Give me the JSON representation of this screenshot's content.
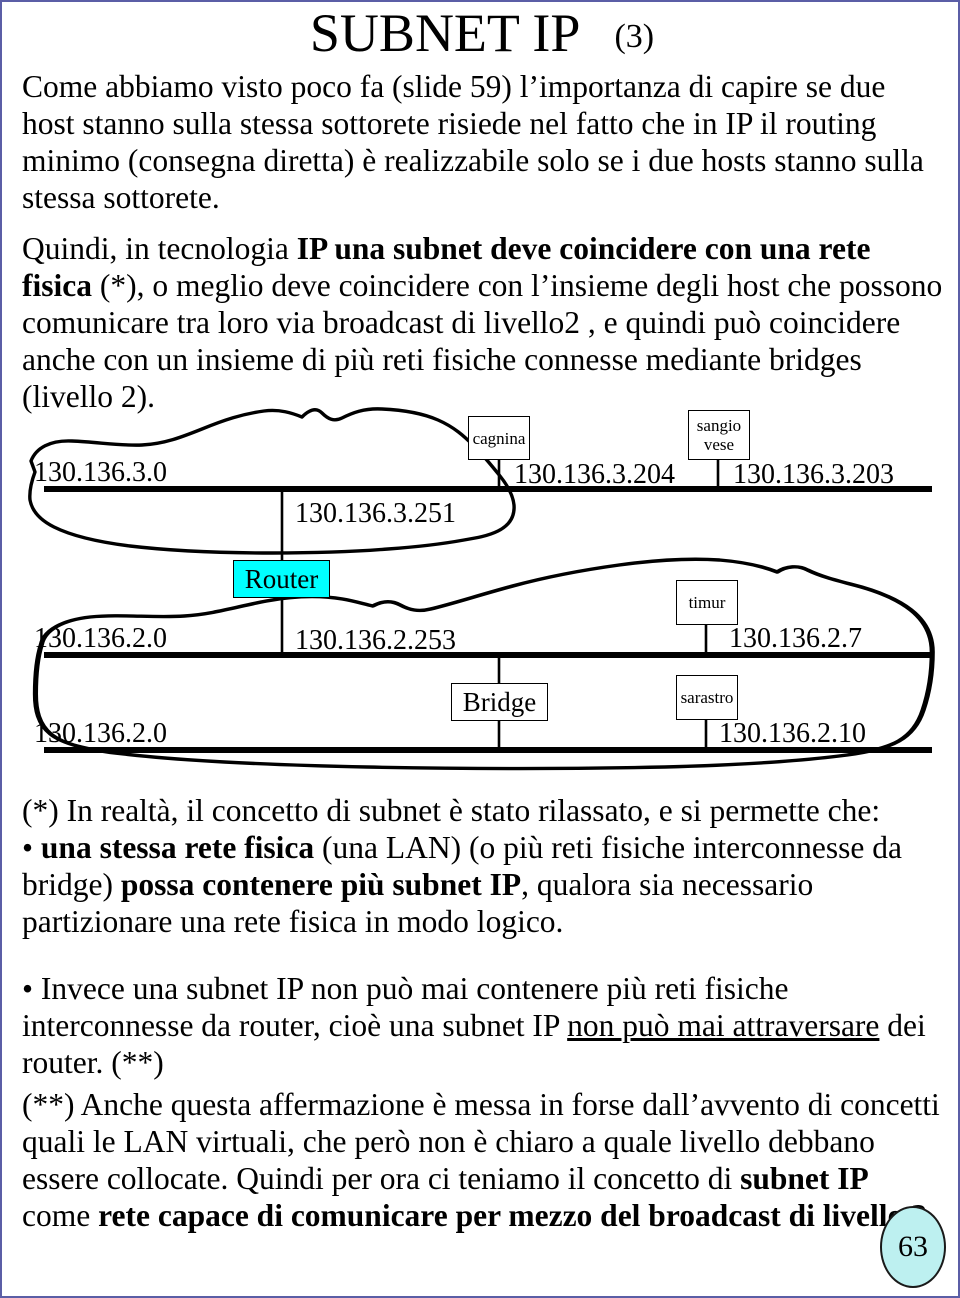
{
  "slide": {
    "border_color": "#5b5ea6",
    "title": "SUBNET IP",
    "title_suffix": "(3)",
    "page_number": "63",
    "page_bubble_color": "#bdf0f0"
  },
  "body": {
    "p1": "Come abbiamo visto poco fa (slide 59) l’importanza di capire se due host stanno sulla stessa sottorete risiede nel fatto che in IP il routing minimo (consegna diretta) è realizzabile solo se i due hosts stanno sulla stessa sottorete.",
    "p2_a": "Quindi, in tecnologia ",
    "p2_b": "IP una subnet deve coincidere con una rete fisica",
    "p2_c": " (*), o meglio deve coincidere con l’insieme degli host che possono comunicare tra loro via broadcast di livello2 , e quindi può coincidere anche con un insieme di più reti fisiche connesse mediante bridges (livello 2).",
    "p3": "(*) In realtà, il concetto di subnet è stato rilassato, e si permette che:",
    "p4_bullet": "•",
    "p4_a": " ",
    "p4_b": "una stessa rete fisica",
    "p4_c": " (una LAN)  (o più reti fisiche interconnesse da bridge) ",
    "p4_d": "possa contenere più subnet IP",
    "p4_e": ", qualora sia necessario partizionare una rete fisica in modo logico.",
    "p5_bullet": "•",
    "p5_a": " Invece una subnet IP non può mai contenere più reti fisiche interconnesse da router, cioè una subnet IP ",
    "p5_u": "non può mai attraversare",
    "p5_b": " dei router. (**)",
    "p6_a": "(**) Anche questa affermazione è messa in forse dall’avvento di concetti quali le LAN virtuali, che però non è chiaro a quale livello debbano essere collocate. Quindi per ora ci teniamo il concetto di ",
    "p6_b": "subnet IP",
    "p6_c": " come ",
    "p6_d": "rete capace di comunicare per mezzo del broadcast di livello 2."
  },
  "diagram": {
    "router_label": "Router",
    "bridge_label": "Bridge",
    "router_color": "#00ffff",
    "subnets": [
      {
        "network": "130.136.3.0",
        "router_if": "130.136.3.251"
      },
      {
        "network": "130.136.2.0",
        "router_if": "130.136.2.253"
      },
      {
        "network": "130.136.2.0",
        "router_if": ""
      }
    ],
    "hosts": [
      {
        "name": "cagnina",
        "name2": "",
        "ip": "130.136.3.204"
      },
      {
        "name": "sangio",
        "name2": "vese",
        "ip": "130.136.3.203"
      },
      {
        "name": "timur",
        "name2": "",
        "ip": "130.136.2.7"
      },
      {
        "name": "sarastro",
        "name2": "",
        "ip": "130.136.2.10"
      }
    ]
  }
}
